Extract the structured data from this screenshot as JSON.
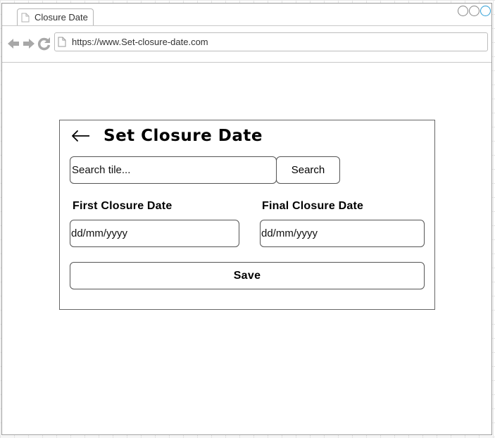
{
  "browser": {
    "tab_title": "Closure Date",
    "url": "https://www.Set-closure-date.com",
    "accent_color": "#2f9fd6"
  },
  "page": {
    "title": "Set Closure Date",
    "search": {
      "placeholder": "Search tile...",
      "button_label": "Search"
    },
    "first_closure": {
      "label": "First Closure Date",
      "placeholder": "dd/mm/yyyy"
    },
    "final_closure": {
      "label": "Final Closure Date",
      "placeholder": "dd/mm/yyyy"
    },
    "save_label": "Save"
  }
}
